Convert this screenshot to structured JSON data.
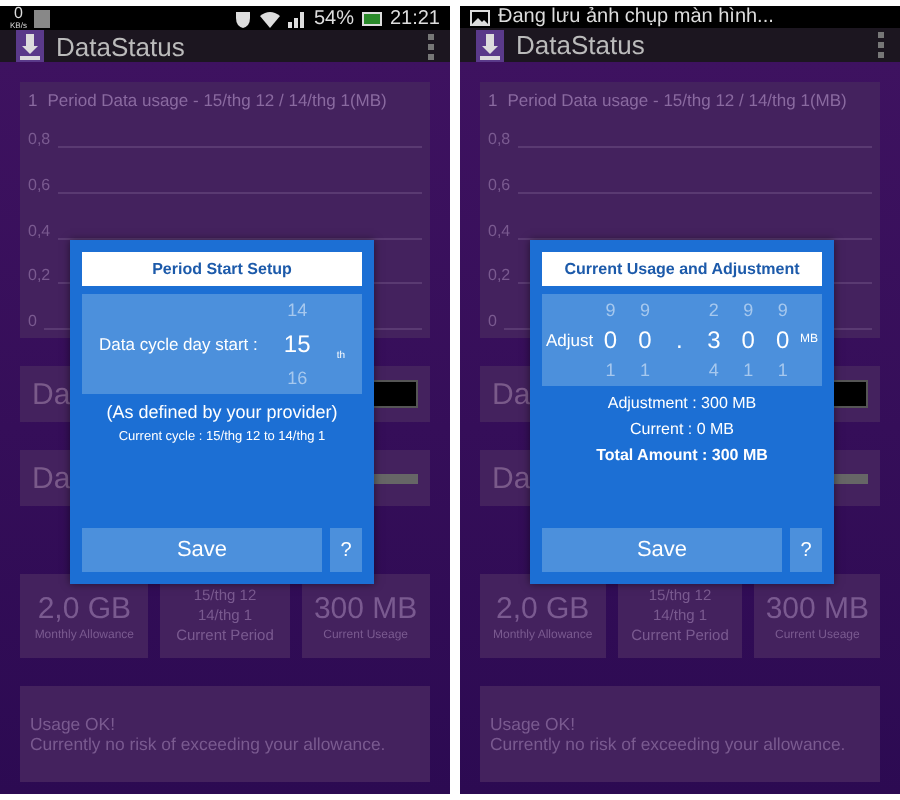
{
  "phones": [
    {
      "status_bar": {
        "kind": "icons",
        "speed": "0",
        "speed_unit": "KB/s",
        "battery": "54%",
        "time": "21:21"
      },
      "app_bar": {
        "title": "DataStatus"
      },
      "chart": {
        "title": "Period Data usage - 15/thg 12 / 14/thg 1(MB)",
        "y_labels": [
          "1",
          "0,8",
          "0,6",
          "0,4",
          "0,2",
          "0"
        ]
      },
      "rows": [
        {
          "label": "Da",
          "kind": "dark-bar"
        },
        {
          "label": "Da",
          "kind": "gray-bar"
        }
      ],
      "stats": [
        {
          "kind": "big",
          "value": "2,0 GB",
          "caption": "Monthly Allowance"
        },
        {
          "kind": "dates",
          "lines": [
            "15/thg 12",
            "14/thg 1"
          ],
          "caption": "Current Period"
        },
        {
          "kind": "big",
          "value": "300 MB",
          "caption": "Current Useage"
        }
      ],
      "message": [
        "Usage OK!",
        "Currently no risk of exceeding your allowance."
      ],
      "dialog": {
        "kind": "cycle",
        "title": "Period Start Setup",
        "label": "Data cycle day start :",
        "above": "14",
        "value": "15",
        "suffix": "th",
        "below": "16",
        "note": "(As defined by your provider)",
        "info": "Current cycle : 15/thg 12 to 14/thg 1",
        "save": "Save",
        "help": "?"
      }
    },
    {
      "status_bar": {
        "kind": "notification",
        "text": "Đang lưu ảnh chụp màn hình..."
      },
      "app_bar": {
        "title": "DataStatus"
      },
      "chart": {
        "title": "Period Data usage - 15/thg 12 / 14/thg 1(MB)",
        "y_labels": [
          "1",
          "0,8",
          "0,6",
          "0,4",
          "0,2",
          "0"
        ]
      },
      "rows": [
        {
          "label": "Da",
          "kind": "dark-bar"
        },
        {
          "label": "Da",
          "kind": "gray-bar"
        }
      ],
      "stats": [
        {
          "kind": "big",
          "value": "2,0 GB",
          "caption": "Monthly Allowance"
        },
        {
          "kind": "dates",
          "lines": [
            "15/thg 12",
            "14/thg 1"
          ],
          "caption": "Current Period"
        },
        {
          "kind": "big",
          "value": "300 MB",
          "caption": "Current Useage"
        }
      ],
      "message": [
        "Usage OK!",
        "Currently no risk of exceeding your allowance."
      ],
      "dialog": {
        "kind": "adjust",
        "title": "Current Usage and Adjustment",
        "label": "Adjust",
        "unit": "MB",
        "columns": [
          {
            "kind": "digit",
            "above": "9",
            "value": "0",
            "below": "1"
          },
          {
            "kind": "digit",
            "above": "9",
            "value": "0",
            "below": "1"
          },
          {
            "kind": "separator",
            "value": "."
          },
          {
            "kind": "digit",
            "above": "2",
            "value": "3",
            "below": "4"
          },
          {
            "kind": "digit",
            "above": "9",
            "value": "0",
            "below": "1"
          },
          {
            "kind": "digit",
            "above": "9",
            "value": "0",
            "below": "1"
          }
        ],
        "lines": [
          {
            "text": "Adjustment :  300 MB",
            "bold": false
          },
          {
            "text": "Current : 0 MB",
            "bold": false
          },
          {
            "text": "Total Amount :  300 MB",
            "bold": true
          }
        ],
        "save": "Save",
        "help": "?"
      }
    }
  ]
}
